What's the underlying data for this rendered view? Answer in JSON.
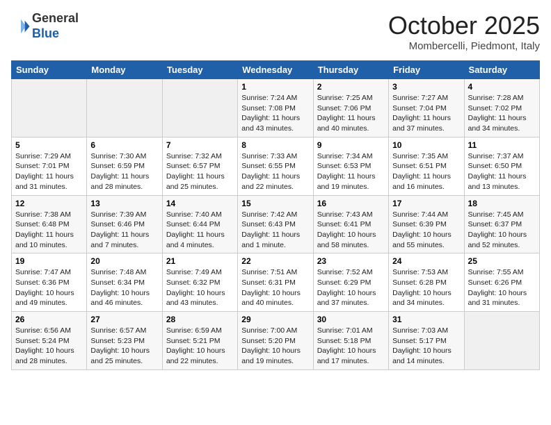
{
  "header": {
    "logo_line1": "General",
    "logo_line2": "Blue",
    "month_title": "October 2025",
    "location": "Mombercelli, Piedmont, Italy"
  },
  "days_of_week": [
    "Sunday",
    "Monday",
    "Tuesday",
    "Wednesday",
    "Thursday",
    "Friday",
    "Saturday"
  ],
  "weeks": [
    [
      {
        "day": "",
        "info": ""
      },
      {
        "day": "",
        "info": ""
      },
      {
        "day": "",
        "info": ""
      },
      {
        "day": "1",
        "info": "Sunrise: 7:24 AM\nSunset: 7:08 PM\nDaylight: 11 hours\nand 43 minutes."
      },
      {
        "day": "2",
        "info": "Sunrise: 7:25 AM\nSunset: 7:06 PM\nDaylight: 11 hours\nand 40 minutes."
      },
      {
        "day": "3",
        "info": "Sunrise: 7:27 AM\nSunset: 7:04 PM\nDaylight: 11 hours\nand 37 minutes."
      },
      {
        "day": "4",
        "info": "Sunrise: 7:28 AM\nSunset: 7:02 PM\nDaylight: 11 hours\nand 34 minutes."
      }
    ],
    [
      {
        "day": "5",
        "info": "Sunrise: 7:29 AM\nSunset: 7:01 PM\nDaylight: 11 hours\nand 31 minutes."
      },
      {
        "day": "6",
        "info": "Sunrise: 7:30 AM\nSunset: 6:59 PM\nDaylight: 11 hours\nand 28 minutes."
      },
      {
        "day": "7",
        "info": "Sunrise: 7:32 AM\nSunset: 6:57 PM\nDaylight: 11 hours\nand 25 minutes."
      },
      {
        "day": "8",
        "info": "Sunrise: 7:33 AM\nSunset: 6:55 PM\nDaylight: 11 hours\nand 22 minutes."
      },
      {
        "day": "9",
        "info": "Sunrise: 7:34 AM\nSunset: 6:53 PM\nDaylight: 11 hours\nand 19 minutes."
      },
      {
        "day": "10",
        "info": "Sunrise: 7:35 AM\nSunset: 6:51 PM\nDaylight: 11 hours\nand 16 minutes."
      },
      {
        "day": "11",
        "info": "Sunrise: 7:37 AM\nSunset: 6:50 PM\nDaylight: 11 hours\nand 13 minutes."
      }
    ],
    [
      {
        "day": "12",
        "info": "Sunrise: 7:38 AM\nSunset: 6:48 PM\nDaylight: 11 hours\nand 10 minutes."
      },
      {
        "day": "13",
        "info": "Sunrise: 7:39 AM\nSunset: 6:46 PM\nDaylight: 11 hours\nand 7 minutes."
      },
      {
        "day": "14",
        "info": "Sunrise: 7:40 AM\nSunset: 6:44 PM\nDaylight: 11 hours\nand 4 minutes."
      },
      {
        "day": "15",
        "info": "Sunrise: 7:42 AM\nSunset: 6:43 PM\nDaylight: 11 hours\nand 1 minute."
      },
      {
        "day": "16",
        "info": "Sunrise: 7:43 AM\nSunset: 6:41 PM\nDaylight: 10 hours\nand 58 minutes."
      },
      {
        "day": "17",
        "info": "Sunrise: 7:44 AM\nSunset: 6:39 PM\nDaylight: 10 hours\nand 55 minutes."
      },
      {
        "day": "18",
        "info": "Sunrise: 7:45 AM\nSunset: 6:37 PM\nDaylight: 10 hours\nand 52 minutes."
      }
    ],
    [
      {
        "day": "19",
        "info": "Sunrise: 7:47 AM\nSunset: 6:36 PM\nDaylight: 10 hours\nand 49 minutes."
      },
      {
        "day": "20",
        "info": "Sunrise: 7:48 AM\nSunset: 6:34 PM\nDaylight: 10 hours\nand 46 minutes."
      },
      {
        "day": "21",
        "info": "Sunrise: 7:49 AM\nSunset: 6:32 PM\nDaylight: 10 hours\nand 43 minutes."
      },
      {
        "day": "22",
        "info": "Sunrise: 7:51 AM\nSunset: 6:31 PM\nDaylight: 10 hours\nand 40 minutes."
      },
      {
        "day": "23",
        "info": "Sunrise: 7:52 AM\nSunset: 6:29 PM\nDaylight: 10 hours\nand 37 minutes."
      },
      {
        "day": "24",
        "info": "Sunrise: 7:53 AM\nSunset: 6:28 PM\nDaylight: 10 hours\nand 34 minutes."
      },
      {
        "day": "25",
        "info": "Sunrise: 7:55 AM\nSunset: 6:26 PM\nDaylight: 10 hours\nand 31 minutes."
      }
    ],
    [
      {
        "day": "26",
        "info": "Sunrise: 6:56 AM\nSunset: 5:24 PM\nDaylight: 10 hours\nand 28 minutes."
      },
      {
        "day": "27",
        "info": "Sunrise: 6:57 AM\nSunset: 5:23 PM\nDaylight: 10 hours\nand 25 minutes."
      },
      {
        "day": "28",
        "info": "Sunrise: 6:59 AM\nSunset: 5:21 PM\nDaylight: 10 hours\nand 22 minutes."
      },
      {
        "day": "29",
        "info": "Sunrise: 7:00 AM\nSunset: 5:20 PM\nDaylight: 10 hours\nand 19 minutes."
      },
      {
        "day": "30",
        "info": "Sunrise: 7:01 AM\nSunset: 5:18 PM\nDaylight: 10 hours\nand 17 minutes."
      },
      {
        "day": "31",
        "info": "Sunrise: 7:03 AM\nSunset: 5:17 PM\nDaylight: 10 hours\nand 14 minutes."
      },
      {
        "day": "",
        "info": ""
      }
    ]
  ]
}
